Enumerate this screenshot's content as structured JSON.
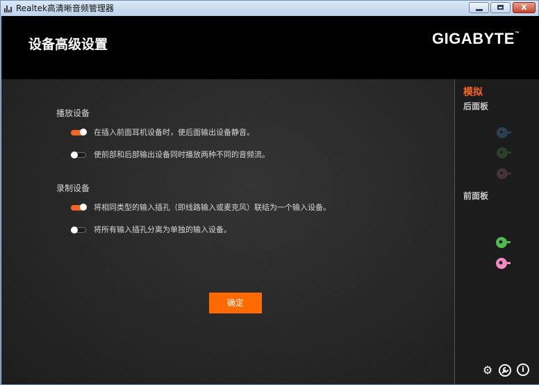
{
  "window": {
    "title": "Realtek高清晰音频管理器",
    "minimize_label": "",
    "maximize_label": "",
    "close_label": "x"
  },
  "header": {
    "page_title": "设备高级设置",
    "brand": "GIGABYTE",
    "brand_mark": "™"
  },
  "playback": {
    "section_label": "播放设备",
    "options": [
      {
        "label": "在插入前面耳机设备时，使后面输出设备静音。",
        "enabled": true
      },
      {
        "label": "使前部和后部输出设备同时播放两种不同的音频流。",
        "enabled": false
      }
    ]
  },
  "recording": {
    "section_label": "录制设备",
    "options": [
      {
        "label": "将相同类型的输入插孔（即线路输入或麦克风）联结为一个输入设备。",
        "enabled": true
      },
      {
        "label": "将所有输入插孔分离为单独的输入设备。",
        "enabled": false
      }
    ]
  },
  "ok_button": "确定",
  "side": {
    "title": "模拟",
    "rear_label": "后面板",
    "front_label": "前面板",
    "rear_jacks": [
      {
        "name": "line-in",
        "color": "#3c6a8f",
        "active": false
      },
      {
        "name": "line-out",
        "color": "#3a6a3a",
        "active": false
      },
      {
        "name": "mic-in",
        "color": "#7a4a5e",
        "active": false
      }
    ],
    "front_jacks": [
      {
        "name": "headphone",
        "color": "#4bbd4b",
        "active": true
      },
      {
        "name": "microphone",
        "color": "#f08ac0",
        "active": true
      }
    ]
  },
  "icons": {
    "settings": "gear-icon",
    "tools": "wrench-icon",
    "info": "info-icon"
  },
  "colors": {
    "accent": "#f26522",
    "button": "#ff6a00",
    "background": "#202020"
  }
}
